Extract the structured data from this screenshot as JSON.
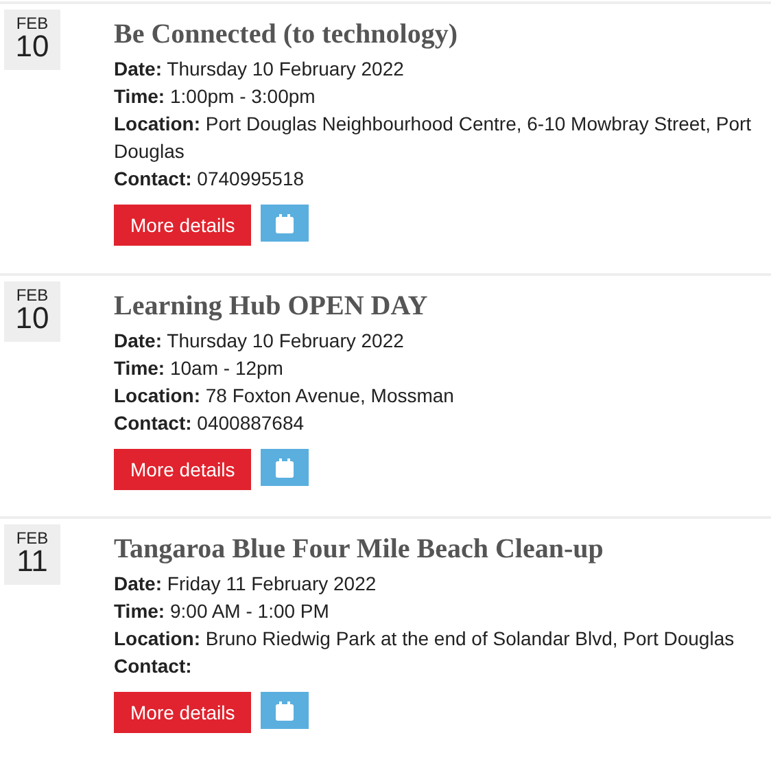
{
  "events": [
    {
      "month": "FEB",
      "day": "10",
      "title": "Be Connected (to technology)",
      "details": [
        "**Date:** Thursday 10 February 2022",
        "**Time:** 1:00pm - 3:00pm",
        "**Location:** Port Douglas Neighbourhood Centre, 6-10 Mowbray Street, Port Douglas",
        "**Contact:** 0740995518"
      ],
      "button": "More details"
    },
    {
      "month": "FEB",
      "day": "10",
      "title": "Learning Hub OPEN DAY",
      "details": [
        "**Date:** Thursday 10 February 2022",
        "**Time:** 10am - 12pm",
        "**Location:** 78 Foxton Avenue, Mossman",
        "**Contact:** 0400887684"
      ],
      "button": "More details"
    },
    {
      "month": "FEB",
      "day": "11",
      "title": "Tangaroa Blue Four Mile Beach Clean-up",
      "details": [
        "**Date:** Friday 11 February 2022",
        "**Time:** 9:00 AM - 1:00 PM",
        "**Location:** Bruno Riedwig Park at the end of Solandar Blvd, Port Douglas",
        "**Contact:**"
      ],
      "button": "More details"
    }
  ]
}
